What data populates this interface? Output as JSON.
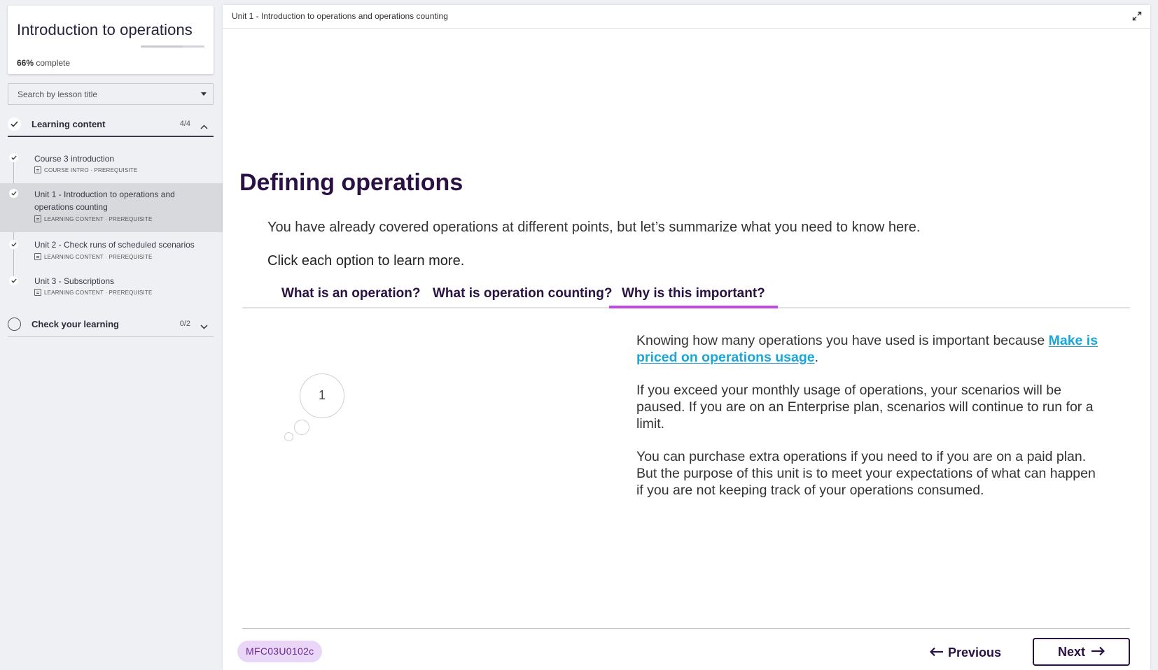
{
  "course": {
    "title": "Introduction to operations",
    "progress_percent": 66,
    "progress_value": "66%",
    "progress_suffix": "complete"
  },
  "search": {
    "placeholder": "Search by lesson title"
  },
  "sections": [
    {
      "label": "Learning content",
      "count": "4/4",
      "expanded": true,
      "completed": true,
      "lessons": [
        {
          "title": "Course 3 introduction",
          "meta": "COURSE INTRO · PREREQUISITE"
        },
        {
          "title": "Unit 1 - Introduction to operations and operations counting",
          "meta": "LEARNING CONTENT · PREREQUISITE"
        },
        {
          "title": "Unit 2 - Check runs of scheduled scenarios",
          "meta": "LEARNING CONTENT · PREREQUISITE"
        },
        {
          "title": "Unit 3 - Subscriptions",
          "meta": "LEARNING CONTENT · PREREQUISITE"
        }
      ]
    },
    {
      "label": "Check your learning",
      "count": "0/2",
      "expanded": false,
      "completed": false
    }
  ],
  "topbar": {
    "breadcrumb": "Unit 1 - Introduction to operations and operations counting",
    "expand_icon": "expand-icon"
  },
  "content": {
    "heading": "Defining operations",
    "intro": "You have already covered operations at different points, but let’s summarize what you need to know here.",
    "instruction": "Click each option to learn more.",
    "tabs": [
      {
        "label": "What is an operation?"
      },
      {
        "label": "What is operation counting?"
      },
      {
        "label": "Why is this important?"
      }
    ],
    "active_tab": 2,
    "step_number": "1",
    "panel": {
      "p1_before": "Knowing how many operations you have used is important because ",
      "p1_link": "Make is priced on operations usage",
      "p1_after": ".",
      "p2": "If you exceed your monthly usage of operations, your scenarios will be paused. If you are on an Enterprise plan, scenarios will continue to run for a limit.",
      "p3": "You can purchase extra operations if you need to if you are on a paid plan. But the purpose of this unit is to meet your expectations of what can happen if you are not keeping track of your operations consumed."
    }
  },
  "footer": {
    "code": "MFC03U0102c",
    "previous_label": "Previous",
    "next_label": "Next"
  },
  "colors": {
    "brand_dark": "#2a1143",
    "tab_accent": "#c14be0",
    "link": "#1aa6d9",
    "pill_bg": "#ead6f7"
  }
}
